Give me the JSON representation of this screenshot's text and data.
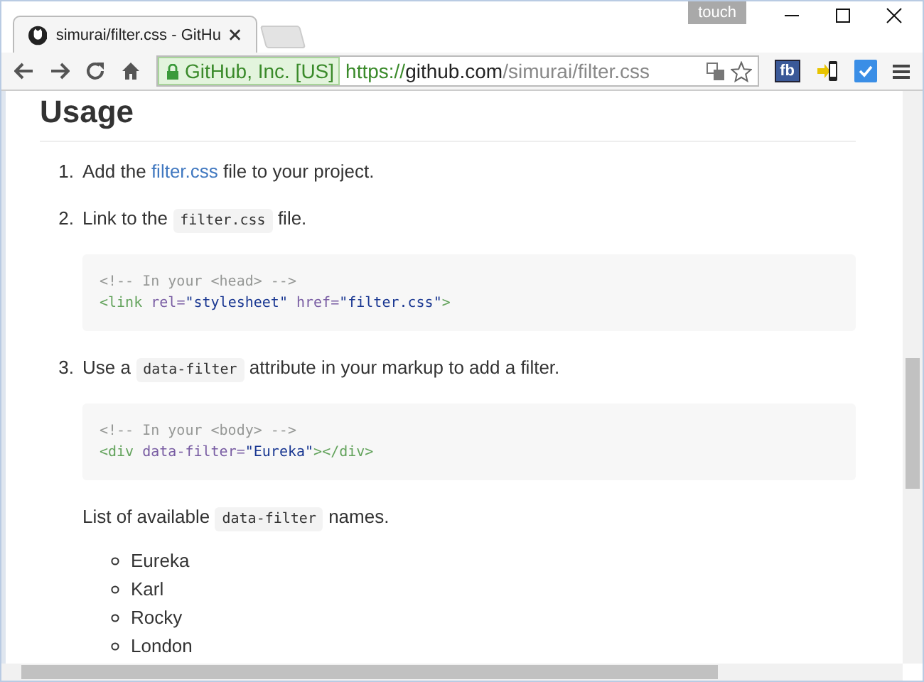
{
  "window": {
    "touch_label": "touch"
  },
  "tabs": [
    {
      "title": "simurai/filter.css - GitHu",
      "selected": true
    }
  ],
  "toolbar": {
    "security_label": "GitHub, Inc. [US]",
    "url": {
      "scheme": "https://",
      "host": "github.com",
      "path": "/simurai/filter.css"
    },
    "extensions": [
      {
        "kind": "fb",
        "label": "fb"
      },
      {
        "kind": "phone"
      },
      {
        "kind": "check"
      }
    ]
  },
  "heading": "Usage",
  "steps": [
    {
      "number": "1.",
      "parts": [
        {
          "kind": "text",
          "text": "Add the "
        },
        {
          "kind": "link",
          "text": "filter.css"
        },
        {
          "kind": "text",
          "text": " file to your project."
        }
      ]
    },
    {
      "number": "2.",
      "parts": [
        {
          "kind": "text",
          "text": "Link to the "
        },
        {
          "kind": "code",
          "text": "filter.css"
        },
        {
          "kind": "text",
          "text": " file."
        }
      ],
      "code_block": [
        [
          {
            "kind": "comment",
            "text": "<!-- In your <head> -->"
          }
        ],
        [
          {
            "kind": "tag",
            "text": "<link"
          },
          {
            "kind": "attr",
            "text": " rel="
          },
          {
            "kind": "string",
            "text": "\"stylesheet\""
          },
          {
            "kind": "attr",
            "text": " href="
          },
          {
            "kind": "string",
            "text": "\"filter.css\""
          },
          {
            "kind": "tag",
            "text": ">"
          }
        ]
      ]
    },
    {
      "number": "3.",
      "parts": [
        {
          "kind": "text",
          "text": "Use a "
        },
        {
          "kind": "code",
          "text": "data-filter"
        },
        {
          "kind": "text",
          "text": " attribute in your markup to add a filter."
        }
      ],
      "code_block": [
        [
          {
            "kind": "comment",
            "text": "<!-- In your <body> -->"
          }
        ],
        [
          {
            "kind": "tag",
            "text": "<div"
          },
          {
            "kind": "attr",
            "text": " data-filter="
          },
          {
            "kind": "string",
            "text": "\"Eureka\""
          },
          {
            "kind": "tag",
            "text": "></div>"
          }
        ]
      ],
      "note": [
        {
          "kind": "text",
          "text": "List of available "
        },
        {
          "kind": "code",
          "text": "data-filter"
        },
        {
          "kind": "text",
          "text": " names."
        }
      ],
      "names": [
        "Eureka",
        "Karl",
        "Rocky",
        "London"
      ]
    }
  ]
}
